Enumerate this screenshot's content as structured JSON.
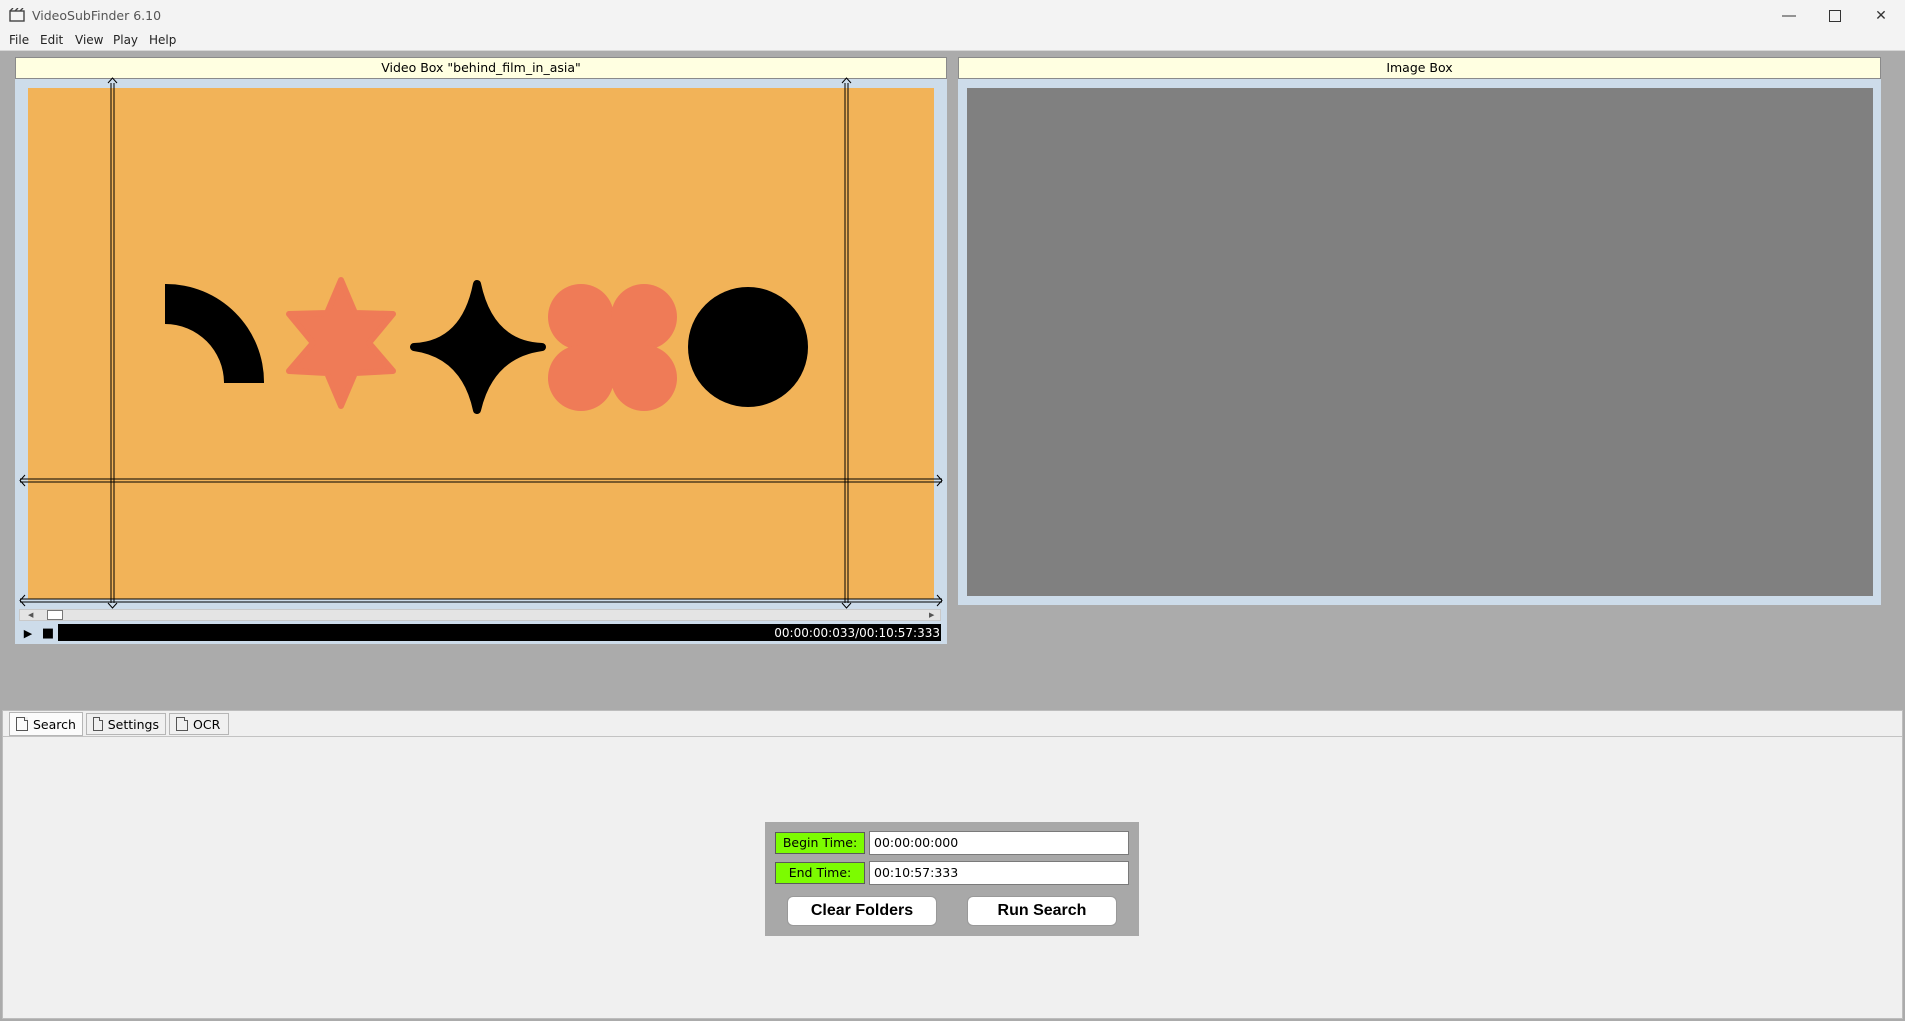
{
  "window": {
    "title": "VideoSubFinder 6.10"
  },
  "menu": [
    "File",
    "Edit",
    "View",
    "Play",
    "Help"
  ],
  "video_box": {
    "title": "Video Box \"behind_film_in_asia\"",
    "time_readout": "00:00:00:033/00:10:57:333",
    "background_color": "#f2b358"
  },
  "image_box": {
    "title": "Image Box",
    "background_color": "#808080"
  },
  "tabs": [
    "Search",
    "Settings",
    "OCR"
  ],
  "search": {
    "begin_label": "Begin Time:",
    "begin_value": "00:00:00:000",
    "end_label": "End Time:",
    "end_value": "00:10:57:333",
    "clear_button": "Clear Folders",
    "run_button": "Run Search"
  },
  "colors": {
    "shape_coral": "#ef7b57",
    "shape_black": "#000000",
    "label_green": "#7cfc00"
  }
}
